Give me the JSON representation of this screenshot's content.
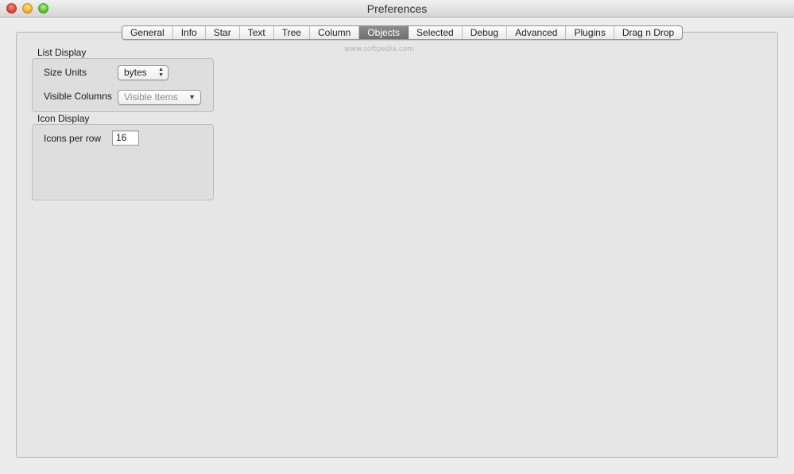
{
  "window": {
    "title": "Preferences"
  },
  "tabs": [
    {
      "label": "General"
    },
    {
      "label": "Info"
    },
    {
      "label": "Star"
    },
    {
      "label": "Text"
    },
    {
      "label": "Tree"
    },
    {
      "label": "Column"
    },
    {
      "label": "Objects"
    },
    {
      "label": "Selected"
    },
    {
      "label": "Debug"
    },
    {
      "label": "Advanced"
    },
    {
      "label": "Plugins"
    },
    {
      "label": "Drag n Drop"
    }
  ],
  "active_tab": "Objects",
  "watermark": "www.softpedia.com",
  "list_display": {
    "title": "List Display",
    "size_units_label": "Size Units",
    "size_units_value": "bytes",
    "visible_columns_label": "Visible Columns",
    "visible_columns_value": "Visible Items"
  },
  "icon_display": {
    "title": "Icon Display",
    "icons_per_row_label": "Icons per row",
    "icons_per_row_value": "16"
  },
  "colors": {
    "active_tab": "#7d7d7d",
    "window_bg": "#ececec",
    "close": "#e0443a",
    "minimize": "#f2b52b",
    "zoom": "#5fc138"
  }
}
